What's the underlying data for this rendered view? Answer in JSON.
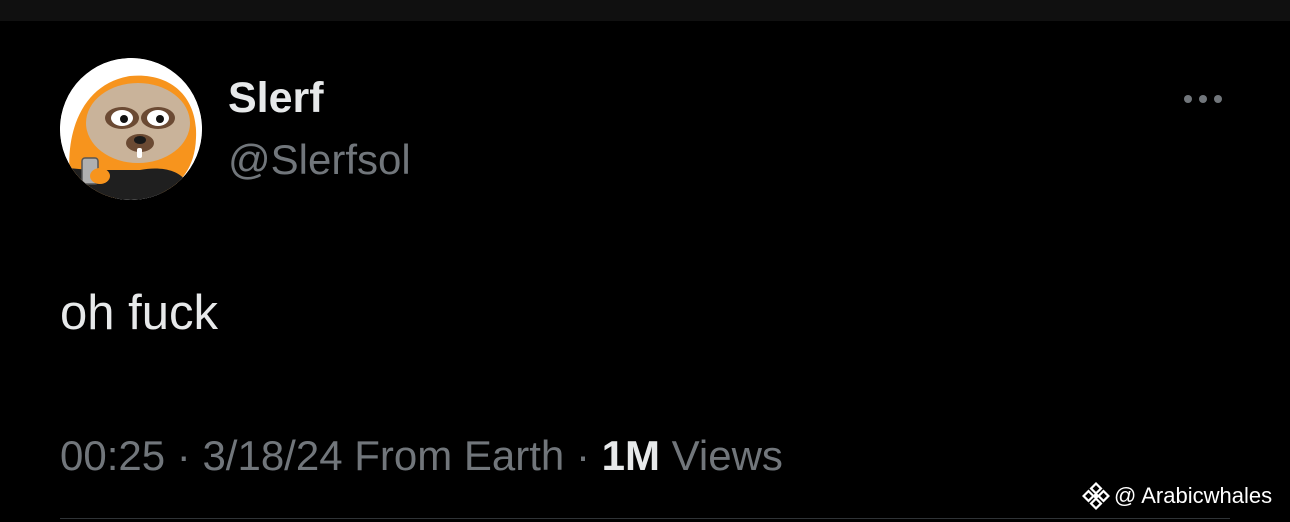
{
  "tweet": {
    "author": {
      "display_name": "Slerf",
      "handle": "@Slerfsol"
    },
    "text": "oh fuck",
    "meta": {
      "time": "00:25",
      "separator": " · ",
      "date": "3/18/24",
      "location": "From Earth",
      "views_count": "1M",
      "views_label": "Views"
    },
    "icons": {
      "more": "more-horizontal-icon",
      "avatar": "sloth-avatar"
    }
  },
  "watermark": {
    "text": "@ Arabicwhales",
    "icon": "binance-diamond-icon"
  },
  "colors": {
    "background": "#000000",
    "primary_text": "#e7e9ea",
    "secondary_text": "#71767b",
    "avatar_accent": "#f7941d"
  }
}
